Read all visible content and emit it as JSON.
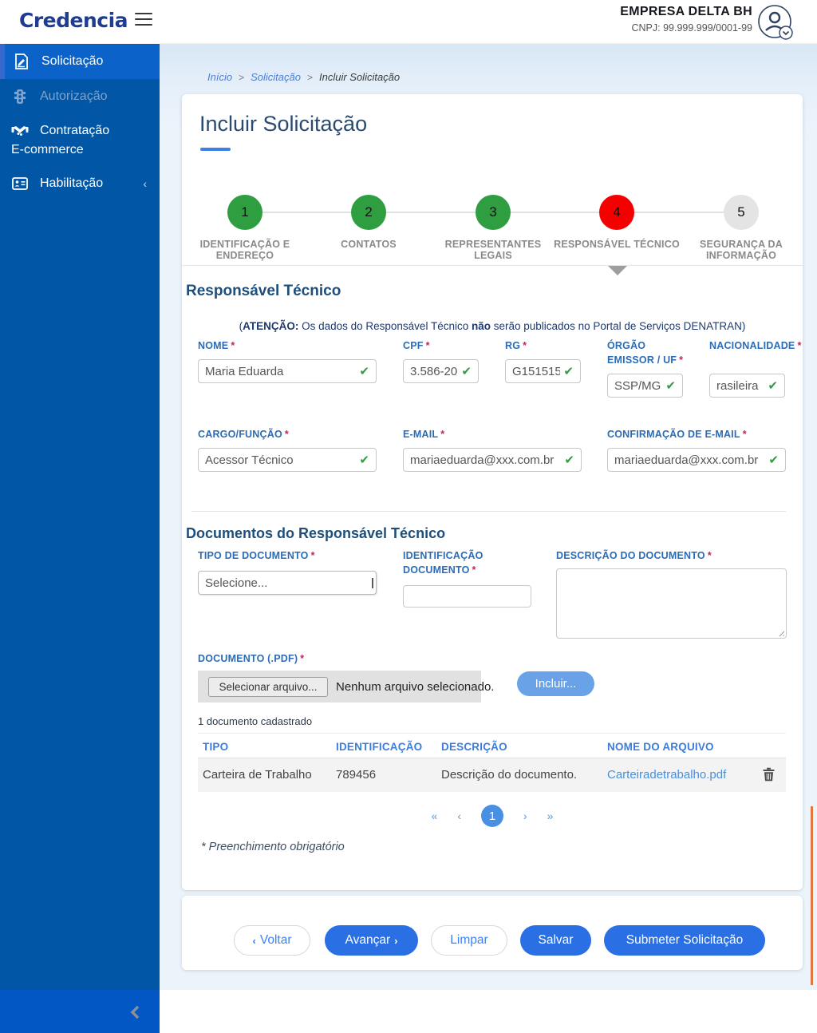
{
  "colors": {
    "sidebar_bg": "#0157A5",
    "sidebar_active": "#0B62C9",
    "primary_button": "#2A6FE4",
    "step_done": "#2E9E41",
    "step_active": "#F40000",
    "step_pending": "#E4E4E4",
    "label_blue": "#2B6CB8",
    "required_asterisk": "#C2255C",
    "link": "#4A90D9",
    "check_green": "#2E9E41"
  },
  "header": {
    "logo": "Credencia",
    "company_name": "EMPRESA DELTA BH",
    "company_cnpj": "CNPJ: 99.999.999/0001-99"
  },
  "sidebar": {
    "items": [
      {
        "label": "Solicitação"
      },
      {
        "label": "Autorização"
      },
      {
        "label_line1": "Contratação",
        "label_line2": "E-commerce"
      },
      {
        "label": "Habilitação",
        "chevron": "‹"
      }
    ]
  },
  "breadcrumb": {
    "home": "Início",
    "section": "Solicitação",
    "current": "Incluir Solicitação",
    "separator": ">"
  },
  "page": {
    "title": "Incluir Solicitação"
  },
  "stepper": {
    "steps": [
      {
        "number": "1",
        "label": "IDENTIFICAÇÃO E ENDEREÇO",
        "state": "done"
      },
      {
        "number": "2",
        "label": "CONTATOS",
        "state": "done"
      },
      {
        "number": "3",
        "label": "REPRESENTANTES LEGAIS",
        "state": "done"
      },
      {
        "number": "4",
        "label": "RESPONSÁVEL TÉCNICO",
        "state": "active"
      },
      {
        "number": "5",
        "label": "SEGURANÇA DA INFORMAÇÃO",
        "state": "pending"
      }
    ]
  },
  "form": {
    "section_title": "Responsável Técnico",
    "note": {
      "p1": "(",
      "b1": "ATENÇÃO:",
      "p2": " Os dados do Responsável Técnico ",
      "b2": "não",
      "p3": " serão publicados no Portal de Serviços DENATRAN)"
    },
    "fields": {
      "nome": {
        "label": "NOME",
        "value": "Maria Eduarda"
      },
      "cpf": {
        "label": "CPF",
        "value": "3.586-20"
      },
      "rg": {
        "label": "RG",
        "value": "G151515"
      },
      "orgao": {
        "label": "ÓRGÃO EMISSOR / UF",
        "value": "SSP/MG"
      },
      "nacionalidade": {
        "label": "NACIONALIDADE",
        "value": "rasileira"
      },
      "cargo": {
        "label": "CARGO/FUNÇÃO",
        "value": "Acessor Técnico"
      },
      "email": {
        "label": "E-MAIL",
        "value": "mariaeduarda@xxx.com.br"
      },
      "confirmacao": {
        "label": "CONFIRMAÇÃO DE E-MAIL",
        "value": "mariaeduarda@xxx.com.br"
      }
    },
    "check_glyph": "✔"
  },
  "documents": {
    "section_title": "Documentos do Responsável Técnico",
    "tipo_label": "TIPO DE DOCUMENTO",
    "tipo_value": "Selecione...",
    "ident_label_line1": "IDENTIFICAÇÃO",
    "ident_label_line2": "DOCUMENTO",
    "ident_value": "",
    "descricao_label": "DESCRIÇÃO DO DOCUMENTO",
    "descricao_value": "",
    "pdf_label": "DOCUMENTO (.PDF)",
    "file_button": "Selecionar arquivo...",
    "file_status": "Nenhum arquivo selecionado.",
    "incluir_button": "Incluir...",
    "count_text": "1 documento cadastrado",
    "table": {
      "headers": {
        "tipo": "TIPO",
        "identificacao": "IDENTIFICAÇÃO",
        "descricao": "DESCRIÇÃO",
        "arquivo": "NOME DO ARQUIVO"
      },
      "rows": [
        {
          "tipo": "Carteira de Trabalho",
          "identificacao": "789456",
          "descricao": "Descrição do documento.",
          "arquivo": "Carteiradetrabalho.pdf"
        }
      ]
    },
    "pagination": {
      "first": "«",
      "prev": "‹",
      "page": "1",
      "next": "›",
      "last": "»"
    }
  },
  "footnote": "* Preenchimento obrigatório",
  "actions": {
    "voltar": {
      "chevron": "‹",
      "label": "Voltar"
    },
    "avancar": {
      "label": "Avançar",
      "chevron": "›"
    },
    "limpar": {
      "label": "Limpar"
    },
    "salvar": {
      "label": "Salvar"
    },
    "submeter": {
      "label": "Submeter Solicitação"
    }
  }
}
